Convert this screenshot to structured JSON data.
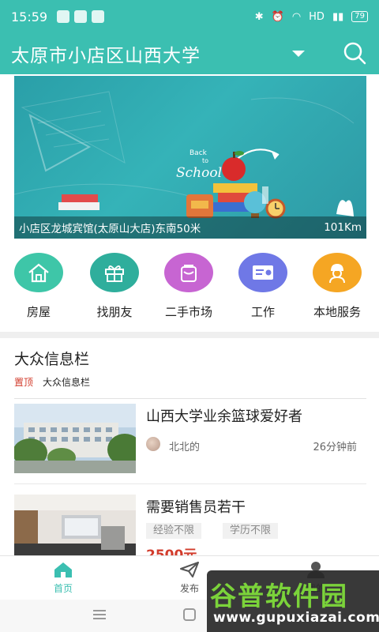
{
  "status_bar": {
    "time": "15:59",
    "network": "HD",
    "battery": "79"
  },
  "header": {
    "title": "太原市小店区山西大学"
  },
  "banner": {
    "location": "小店区龙城宾馆(太原山大店)东南50米",
    "distance": "101Km",
    "art_text_1": "Back",
    "art_text_2": "to",
    "art_text_3": "School"
  },
  "categories": [
    {
      "label": "房屋",
      "icon": "house-icon",
      "color": "#3ec6a8"
    },
    {
      "label": "找朋友",
      "icon": "gift-icon",
      "color": "#2fae9c"
    },
    {
      "label": "二手市场",
      "icon": "bag-icon",
      "color": "#c765d2"
    },
    {
      "label": "工作",
      "icon": "id-card-icon",
      "color": "#6f78e6"
    },
    {
      "label": "本地服务",
      "icon": "worker-icon",
      "color": "#f5a623"
    }
  ],
  "info": {
    "title": "大众信息栏",
    "pinned": "置顶",
    "subtitle": "大众信息栏"
  },
  "posts": [
    {
      "title": "山西大学业余篮球爱好者",
      "author": "北北的",
      "time": "26分钟前"
    },
    {
      "title": "需要销售员若干",
      "tags": [
        "经验不限",
        "学历不限"
      ],
      "price": "2500元"
    }
  ],
  "tabbar": [
    {
      "label": "首页",
      "icon": "home-icon"
    },
    {
      "label": "发布",
      "icon": "paper-plane-icon"
    },
    {
      "label": "我的",
      "icon": "user-icon"
    }
  ],
  "watermark": {
    "brand": "谷普软件园",
    "url": "www.gupuxiazai.com"
  },
  "colors": {
    "primary": "#3bbfb1",
    "price": "#d23c2c"
  }
}
